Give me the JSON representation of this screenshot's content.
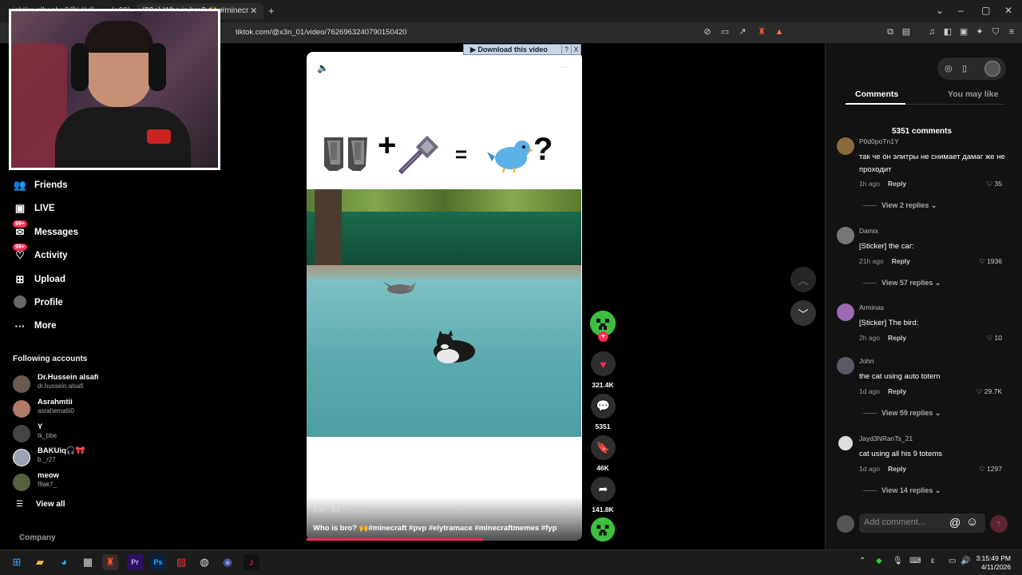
{
  "browser": {
    "tabs": [
      {
        "label": "iak!/m alhasha2@!.!/ull_..... (+99)"
      },
      {
        "label": "(99+) Who is bro? 🙌 #minecr"
      }
    ],
    "new_tab": "+",
    "url": "tiktok.com/@x3n_01/video/7626963240790150420",
    "window_controls": [
      "⌄",
      "–",
      "▢",
      "✕"
    ]
  },
  "nav": {
    "items": [
      {
        "label": "Friends",
        "icon": "friends-icon"
      },
      {
        "label": "LIVE",
        "icon": "live-icon"
      },
      {
        "label": "Messages",
        "icon": "messages-icon",
        "badge": "99+"
      },
      {
        "label": "Activity",
        "icon": "activity-icon",
        "badge": "99+"
      },
      {
        "label": "Upload",
        "icon": "upload-icon"
      },
      {
        "label": "Profile",
        "icon": "profile-icon"
      },
      {
        "label": "More",
        "icon": "more-icon"
      }
    ],
    "following_title": "Following accounts",
    "accounts": [
      {
        "name": "Dr.Hussein alsafi",
        "handle": "dr.hussein.alsafi",
        "color": "#6b5a4e"
      },
      {
        "name": "Asrahmtii",
        "handle": "asrahematii0",
        "color": "#b37a6a"
      },
      {
        "name": "Y",
        "handle": "tk_bbe",
        "color": "#444"
      },
      {
        "name": "BAKUiq🎧🎀",
        "handle": "b._r27",
        "color": "#9aa3b5"
      },
      {
        "name": "meow",
        "handle": "f8ak7_",
        "color": "#556040"
      }
    ],
    "view_all": "View all",
    "company": "Company"
  },
  "video": {
    "download_bar": "▶ Download this video",
    "download_help": "?",
    "download_close": "X",
    "more_dots": "···",
    "eq_plus": "+",
    "eq_equals": "=",
    "eq_question": "?",
    "author": "x3n_01",
    "ago": " · 1d ago",
    "caption": "Who is bro? 🙌#minecraft #pvp #elytramace #minecraftmemes #fyp",
    "progress": 0.64
  },
  "actions": {
    "likes": "321.4K",
    "comments": "5351",
    "saves": "46K",
    "shares": "141.8K"
  },
  "panel": {
    "tab_comments": "Comments",
    "tab_like": "You may like",
    "count": "5351 comments",
    "comments": [
      {
        "user": "P0d0poTn1Y",
        "text": "так че он элитры не снимает дамаг же не проходит",
        "time": "1h ago",
        "reply": "Reply",
        "likes": "35",
        "view": "View 2 replies",
        "color": "#8a6a3a"
      },
      {
        "user": "Damix",
        "text": "[Sticker] the car:",
        "time": "21h ago",
        "reply": "Reply",
        "likes": "1936",
        "view": "View 57 replies",
        "color": "#777"
      },
      {
        "user": "Arminas",
        "text": "[Sticker] The bird:",
        "time": "2h ago",
        "reply": "Reply",
        "likes": "10",
        "view": "",
        "color": "#9b6bb5"
      },
      {
        "user": "John",
        "text": "the cat using auto totem",
        "time": "1d ago",
        "reply": "Reply",
        "likes": "29.7K",
        "view": "View 59 replies",
        "color": "#5a5a6a"
      },
      {
        "user": "Jayd3NRanTs_21",
        "text": "cat using all his 9 totems",
        "time": "1d ago",
        "reply": "Reply",
        "likes": "1297",
        "view": "View 14 replies",
        "color": "#ddd"
      }
    ],
    "add_comment_placeholder": "Add comment...",
    "at": "@",
    "emoji": "☺"
  },
  "taskbar": {
    "time": "3:15:49 PM",
    "date": "4/11/2026",
    "lang": "ε"
  }
}
